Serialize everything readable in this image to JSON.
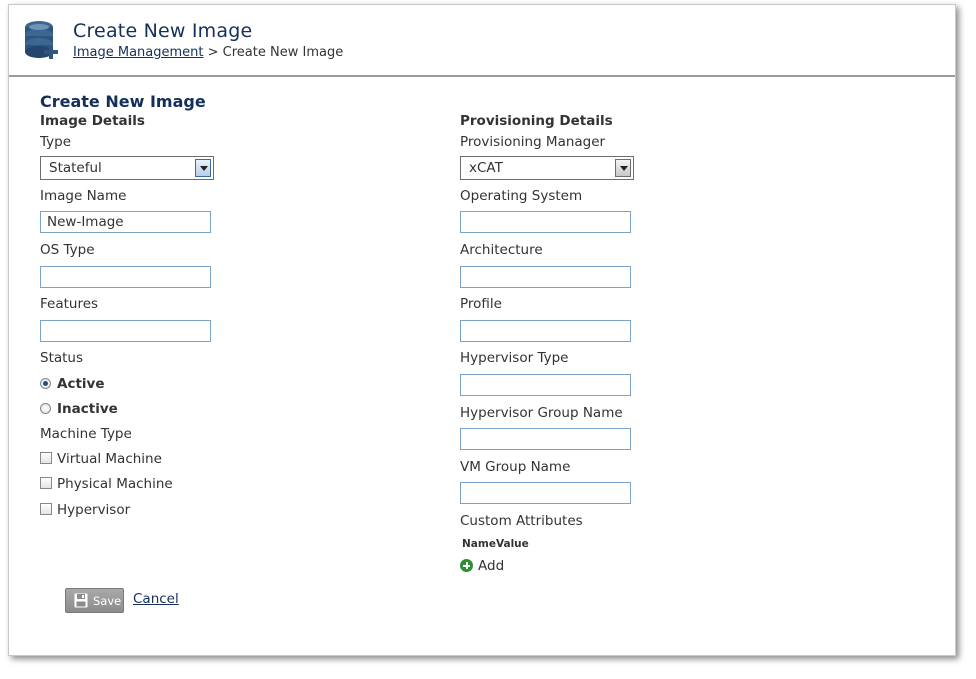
{
  "header": {
    "title": "Create New Image",
    "breadcrumb": {
      "parent": "Image Management",
      "separator": ">",
      "current": "Create New Image"
    }
  },
  "form": {
    "title": "Create New Image",
    "image_details": {
      "section_title": "Image Details",
      "type_label": "Type",
      "type_value": "Stateful",
      "image_name_label": "Image Name",
      "image_name_value": "New-Image",
      "os_type_label": "OS Type",
      "os_type_value": "",
      "features_label": "Features",
      "features_value": "",
      "status_label": "Status",
      "status_options": [
        {
          "label": "Active",
          "selected": true
        },
        {
          "label": "Inactive",
          "selected": false
        }
      ],
      "machine_type_label": "Machine Type",
      "machine_types": [
        {
          "label": "Virtual Machine",
          "checked": false
        },
        {
          "label": "Physical Machine",
          "checked": false
        },
        {
          "label": "Hypervisor",
          "checked": false
        }
      ]
    },
    "provisioning_details": {
      "section_title": "Provisioning Details",
      "manager_label": "Provisioning Manager",
      "manager_value": "xCAT",
      "operating_system_label": "Operating System",
      "operating_system_value": "",
      "architecture_label": "Architecture",
      "architecture_value": "",
      "profile_label": "Profile",
      "profile_value": "",
      "hypervisor_type_label": "Hypervisor Type",
      "hypervisor_type_value": "",
      "hypervisor_group_label": "Hypervisor Group Name",
      "hypervisor_group_value": "",
      "vm_group_label": "VM Group Name",
      "vm_group_value": "",
      "custom_attributes_label": "Custom Attributes",
      "attr_columns": [
        "Name",
        "Value"
      ],
      "add_label": "Add"
    }
  },
  "actions": {
    "save_label": "Save",
    "cancel_label": "Cancel"
  },
  "icons": {
    "header": "database-add-icon",
    "save": "floppy-disk-icon",
    "add": "plus-circle-icon"
  },
  "colors": {
    "title": "#14305a",
    "add_icon": "#2f8f34",
    "save_button": "#999999"
  }
}
